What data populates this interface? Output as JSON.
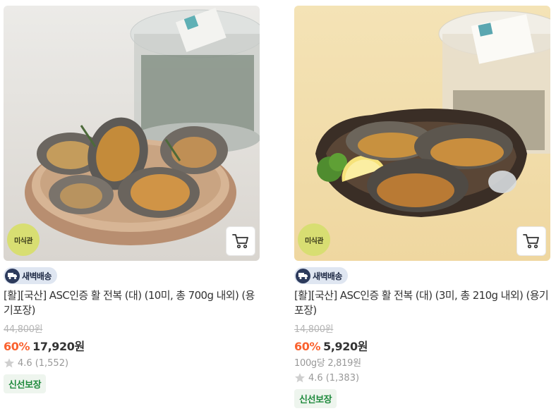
{
  "products": [
    {
      "badge": "미식관",
      "delivery": "새벽배송",
      "name": "[활][국산] ASC인증 활 전복 (대) (10미, 총 700g 내외) (용기포장)",
      "original_price": "44,800원",
      "discount": "60%",
      "price": "17,920원",
      "unit_price": "",
      "rating": "4.6",
      "review_count": "(1,552)",
      "tag": "신선보장",
      "tag_color": "#1e8a3c",
      "photo_bg": "#e9e6e1",
      "image_icon": "abalone-on-plate-photo"
    },
    {
      "badge": "미식관",
      "delivery": "새벽배송",
      "name": "[활][국산] ASC인증 활 전복 (대) (3미, 총 210g 내외) (용기포장)",
      "original_price": "14,800원",
      "discount": "60%",
      "price": "5,920원",
      "unit_price": "100g당 2,819원",
      "rating": "4.6",
      "review_count": "(1,383)",
      "tag": "신선보장",
      "tag_color": "#1e8a3c",
      "photo_bg": "#f2dfae",
      "image_icon": "abalone-in-bowl-photo"
    }
  ],
  "colors": {
    "discount": "#fa622f",
    "badge_bg": "#d8de72",
    "delivery_bg": "#dfe6f1"
  }
}
